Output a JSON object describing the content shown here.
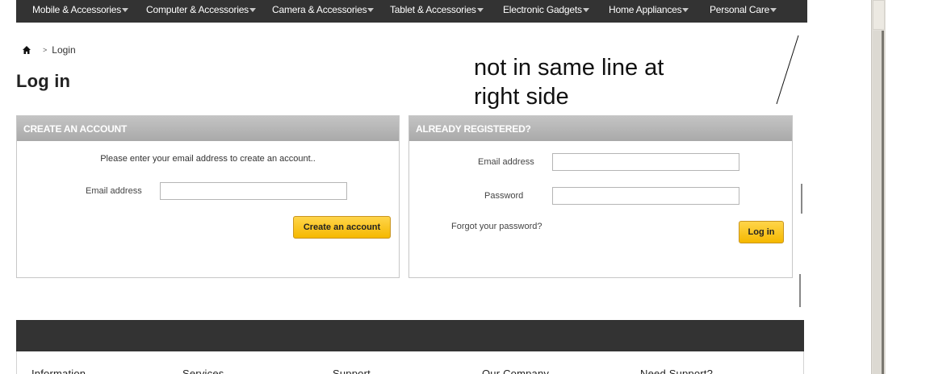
{
  "nav": {
    "items": [
      {
        "label": "Mobile & Accessories"
      },
      {
        "label": "Computer & Accessories"
      },
      {
        "label": "Camera & Accessories"
      },
      {
        "label": "Tablet & Accessories"
      },
      {
        "label": "Electronic Gadgets"
      },
      {
        "label": "Home Appliances"
      },
      {
        "label": "Personal Care"
      }
    ],
    "caret_icon": "caret-down-icon"
  },
  "breadcrumb": {
    "home_icon": "home-icon",
    "separator": ">",
    "current": "Login"
  },
  "page": {
    "title": "Log in"
  },
  "annotation": {
    "text": "not in same line at\nright side"
  },
  "create_account": {
    "header": "CREATE AN ACCOUNT",
    "intro": "Please enter your email address to create an account..",
    "email_label": "Email address",
    "email_value": "",
    "button_label": "Create an account"
  },
  "login": {
    "header": "ALREADY REGISTERED?",
    "email_label": "Email address",
    "email_value": "",
    "password_label": "Password",
    "password_value": "",
    "forgot_label": "Forgot your password?",
    "button_label": "Log in"
  },
  "footer": {
    "columns": [
      "Information",
      "Services",
      "Support",
      "Our Company",
      "Need Support?"
    ]
  },
  "colors": {
    "nav_bg": "#333333",
    "header_bg": "#a9a9a9",
    "button_yellow": "#f5b800",
    "footer_bg": "#333333"
  }
}
